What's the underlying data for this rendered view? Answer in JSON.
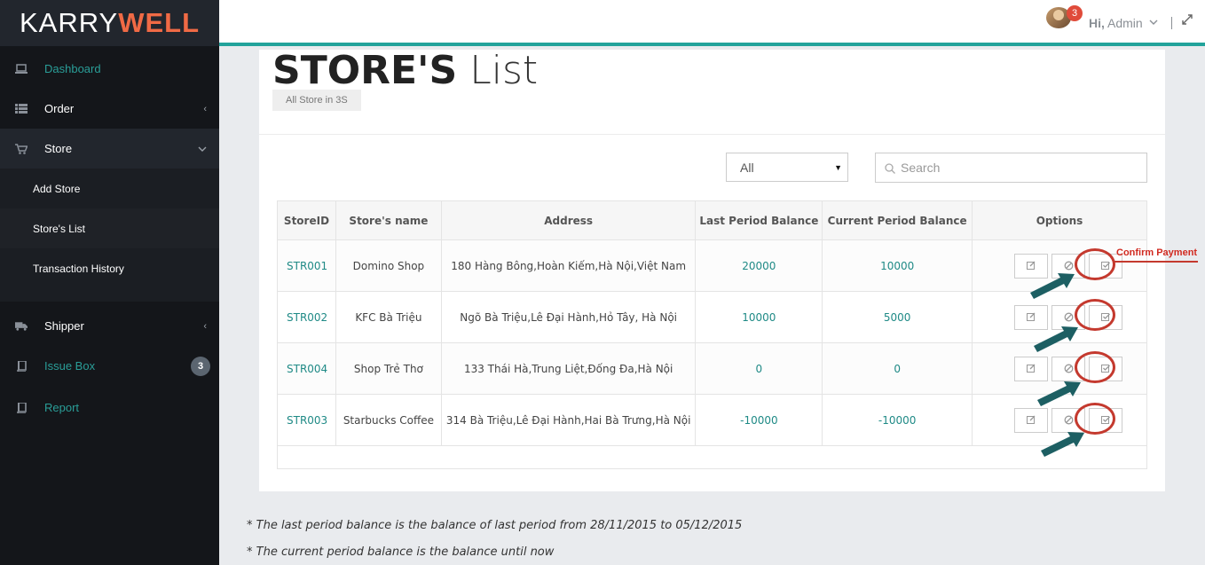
{
  "brand": {
    "part1": "KARRY",
    "part2": "WELL"
  },
  "sidebar": {
    "items": [
      {
        "label": "Dashboard",
        "icon": "laptop-icon"
      },
      {
        "label": "Order",
        "icon": "list-icon"
      },
      {
        "label": "Store",
        "icon": "cart-icon"
      },
      {
        "label": "Shipper",
        "icon": "truck-icon"
      },
      {
        "label": "Issue Box",
        "icon": "book-icon",
        "badge": "3"
      },
      {
        "label": "Report",
        "icon": "book-icon"
      }
    ],
    "store_subitems": [
      {
        "label": "Add Store"
      },
      {
        "label": "Store's List"
      },
      {
        "label": "Transaction History"
      }
    ]
  },
  "topbar": {
    "notif_count": "3",
    "hi": "Hi,",
    "user": "Admin"
  },
  "page": {
    "title_bold": "STORE'S",
    "title_light": "List",
    "breadcrumb": "All Store in 3S"
  },
  "filters": {
    "select_value": "All",
    "search_placeholder": "Search"
  },
  "table": {
    "columns": [
      "StoreID",
      "Store's name",
      "Address",
      "Last Period Balance",
      "Current Period Balance",
      "Options"
    ],
    "rows": [
      {
        "id": "STR001",
        "name": "Domino Shop",
        "address": "180 Hàng Bông,Hoàn Kiếm,Hà Nội,Việt Nam",
        "last": "20000",
        "current": "10000"
      },
      {
        "id": "STR002",
        "name": "KFC Bà Triệu",
        "address": "Ngõ Bà Triệu,Lê Đại Hành,Hỏ Tây, Hà Nội",
        "last": "10000",
        "current": "5000"
      },
      {
        "id": "STR004",
        "name": "Shop Trẻ Thơ",
        "address": "133 Thái Hà,Trung Liệt,Đống Đa,Hà Nội",
        "last": "0",
        "current": "0"
      },
      {
        "id": "STR003",
        "name": "Starbucks Coffee",
        "address": "314 Bà Triệu,Lê Đại Hành,Hai Bà Trưng,Hà Nội",
        "last": "-10000",
        "current": "-10000"
      }
    ]
  },
  "annotation": {
    "confirm_label": "Confirm Payment"
  },
  "notes": [
    "* The last period balance is the balance of last period from 28/11/2015 to 05/12/2015",
    "* The current period balance is the balance until now"
  ],
  "colors": {
    "accent": "#22a39b",
    "brand_orange": "#f06a45",
    "annotation_red": "#c4392e",
    "arrow_teal": "#1d5f63"
  }
}
